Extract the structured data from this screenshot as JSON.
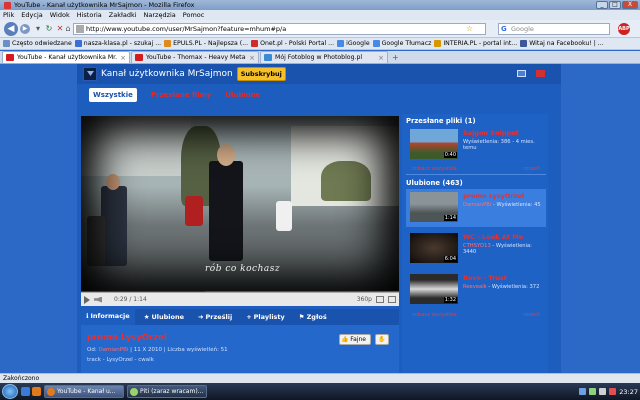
{
  "window": {
    "title": "YouTube - Kanał użytkownika MrSajmon - Mozilla Firefox",
    "controls": [
      "_",
      "□",
      "X"
    ]
  },
  "menu": [
    "Plik",
    "Edycja",
    "Widok",
    "Historia",
    "Zakładki",
    "Narzędzia",
    "Pomoc"
  ],
  "nav": {
    "url": "http://www.youtube.com/user/MrSajmon?feature=mhum#p/a",
    "search_placeholder": "Google",
    "search_logo": "G",
    "abp_label": "ABP"
  },
  "bookmarks": [
    {
      "label": "Często odwiedzane",
      "color": "#6a8fc4"
    },
    {
      "label": "nasza-klasa.pl - szukaj ...",
      "color": "#3b6ed8"
    },
    {
      "label": "EPULS.PL - Najlepsza (...",
      "color": "#e08a1a"
    },
    {
      "label": "Onet.pl - Polski Portal ...",
      "color": "#d02b2b"
    },
    {
      "label": "iGoogle",
      "color": "#4a88e8"
    },
    {
      "label": "Google Tłumacz",
      "color": "#4a88e8"
    },
    {
      "label": "INTERIA.PL - portal int...",
      "color": "#d69a00"
    },
    {
      "label": "Witaj na Facebooku! | ...",
      "color": "#3b5998"
    }
  ],
  "tabs": [
    {
      "label": "YouTube - Kanał użytkownika Mr...",
      "active": true
    },
    {
      "label": "YouTube - Thomax - Heavy Metal K...",
      "active": false
    },
    {
      "label": "Mój Fotoblog w Photoblog.pl",
      "active": false
    }
  ],
  "channel": {
    "name": "Kanał użytkownika MrSajmon",
    "subscribe": "Subskrybuj",
    "filters": [
      "Wszystkie",
      "Przesłane filmy",
      "Ulubione"
    ]
  },
  "player": {
    "overlay_text": "rób co kochasz",
    "time": "0:29 / 1:14",
    "quality": "360p",
    "progress": 0.39
  },
  "video_tabs": [
    {
      "label": "Informacje",
      "sym": "ℹ"
    },
    {
      "label": "Ulubione",
      "sym": "★"
    },
    {
      "label": "Prześlij",
      "sym": "➜"
    },
    {
      "label": "Playlisty",
      "sym": "+"
    },
    {
      "label": "Zgłoś",
      "sym": "⚑"
    }
  ],
  "video_info": {
    "title": "promo LysyOrzel",
    "from_label": "Od:",
    "uploader": "DamianPBi",
    "date_views": "| 11 X 2010 | Liczba wyświetleń: 51",
    "description": "track - LysyOrzel - cwalk",
    "like": "Fajne",
    "dislike": "✋"
  },
  "sidebar": {
    "uploads_header": "Przesłane pliki (1)",
    "uploads": [
      {
        "title": "Sajgon Snippet",
        "meta": "Wyświetlenia: 386 - 4 mies. temu",
        "duration": "0:40"
      }
    ],
    "link_all": "zobacz wszystkie",
    "link_more": "rozwiń",
    "favorites_header": "Ulubione (463)",
    "favorites": [
      {
        "title": "promo LysyOrzel",
        "user": "DamianPBi",
        "meta": "Wyświetlenia: 45",
        "duration": "1:14"
      },
      {
        "title": "WC - Look At Me",
        "user": "CTHSYD13",
        "meta": "Wyświetlenia: 3440",
        "duration": "6:04"
      },
      {
        "title": "Reve - Trust",
        "user": "Reevealk",
        "meta": "Wyświetlenia: 372",
        "duration": "1:32"
      }
    ]
  },
  "status": "Zakończono",
  "taskbar": {
    "items": [
      {
        "label": "YouTube - Kanał u...",
        "active": true
      },
      {
        "label": "Piti (zaraz wracam)...",
        "active": false
      }
    ],
    "clock": "23:27"
  }
}
